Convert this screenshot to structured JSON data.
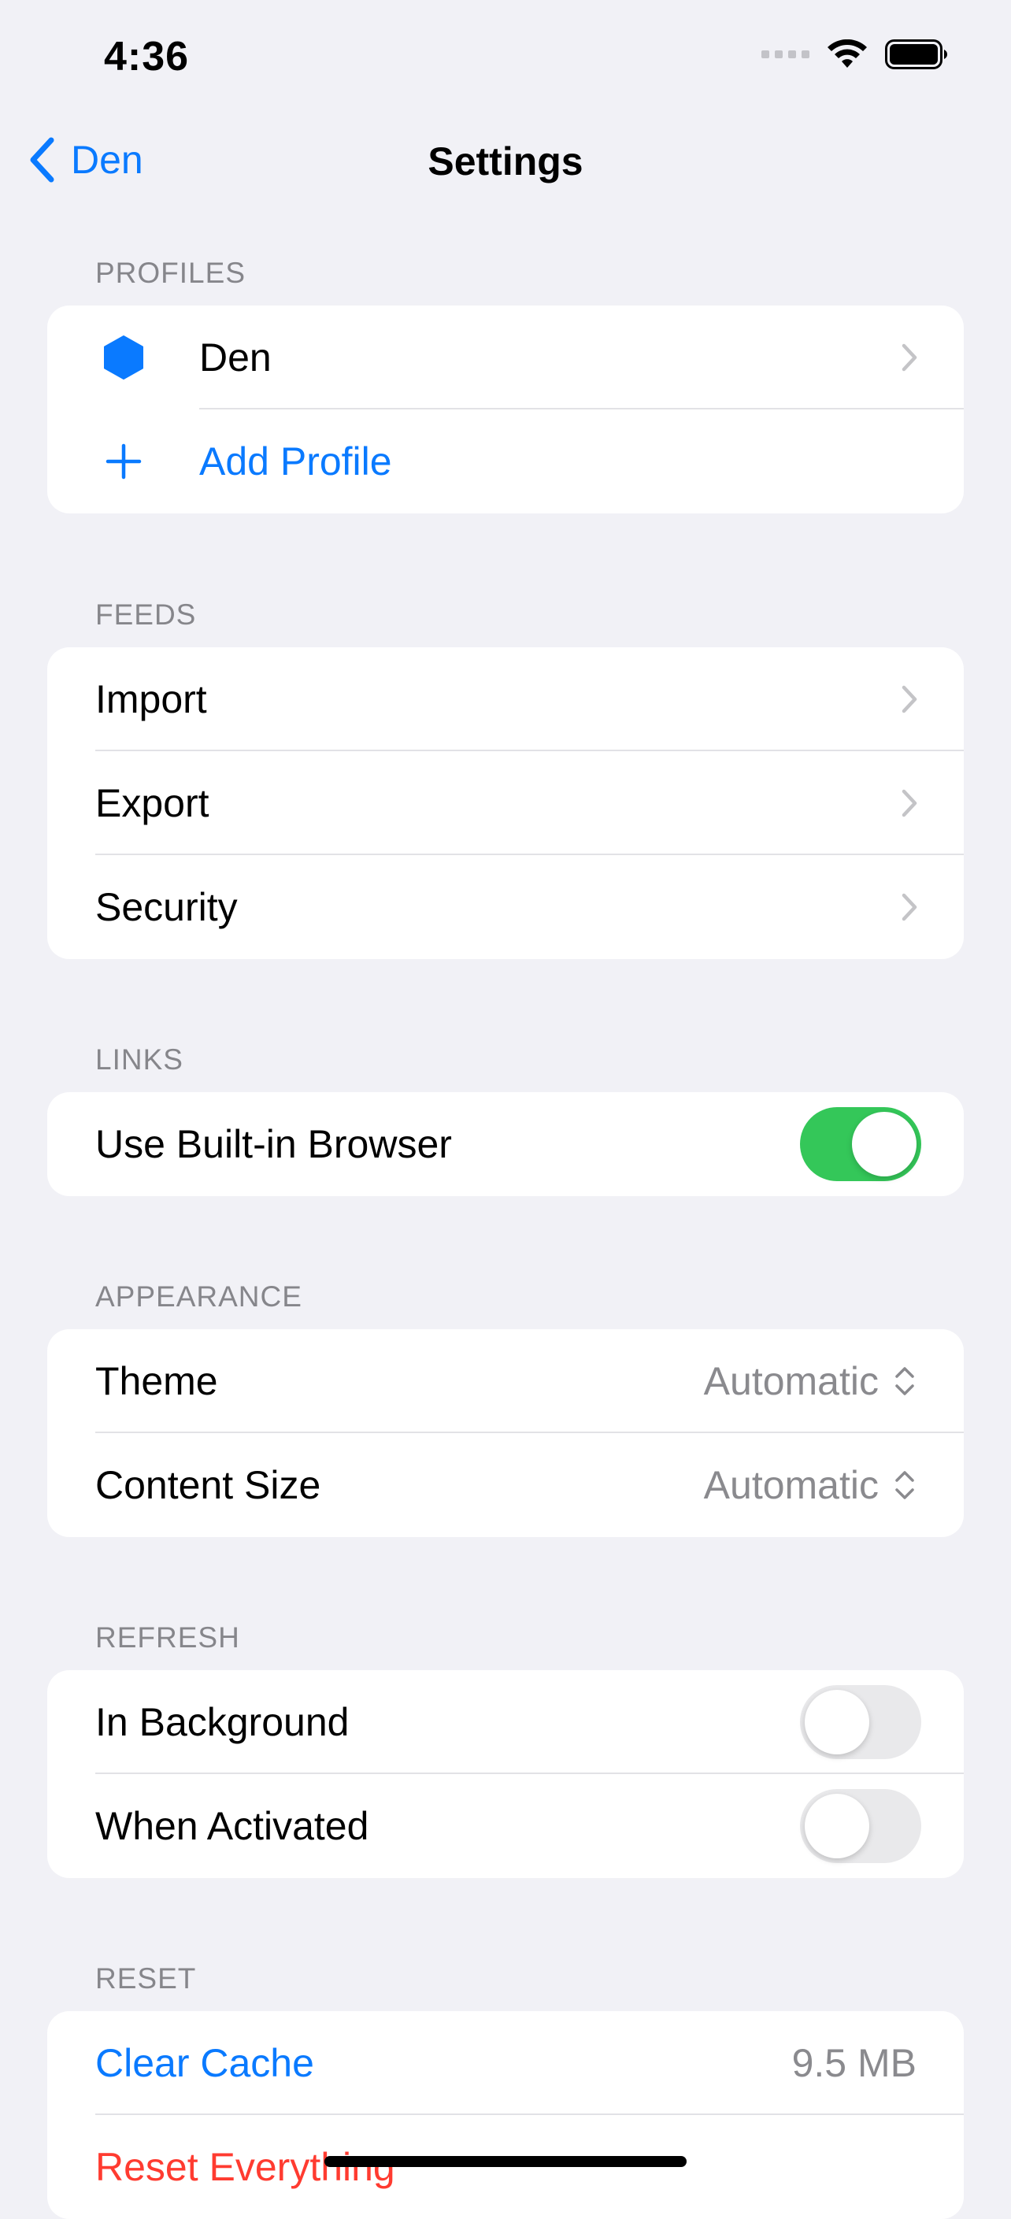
{
  "status_bar": {
    "time": "4:36"
  },
  "nav": {
    "back_label": "Den",
    "title": "Settings"
  },
  "profiles": {
    "header": "PROFILES",
    "items": [
      {
        "label": "Den",
        "icon": "hexagon-icon",
        "icon_color": "#0A7AFF"
      }
    ],
    "add_label": "Add Profile"
  },
  "feeds": {
    "header": "FEEDS",
    "items": [
      {
        "label": "Import"
      },
      {
        "label": "Export"
      },
      {
        "label": "Security"
      }
    ]
  },
  "links": {
    "header": "LINKS",
    "built_in_browser": {
      "label": "Use Built-in Browser",
      "on": true
    }
  },
  "appearance": {
    "header": "APPEARANCE",
    "theme": {
      "label": "Theme",
      "value": "Automatic"
    },
    "content_size": {
      "label": "Content Size",
      "value": "Automatic"
    }
  },
  "refresh": {
    "header": "REFRESH",
    "in_background": {
      "label": "In Background",
      "on": false
    },
    "when_activated": {
      "label": "When Activated",
      "on": false
    }
  },
  "reset": {
    "header": "RESET",
    "clear_cache": {
      "label": "Clear Cache",
      "value": "9.5 MB"
    },
    "reset_everything": {
      "label": "Reset Everything"
    }
  },
  "colors": {
    "accent": "#0A7AFF",
    "toggle_on": "#34C759",
    "destructive": "#FF3B30",
    "background": "#F1F1F6"
  }
}
